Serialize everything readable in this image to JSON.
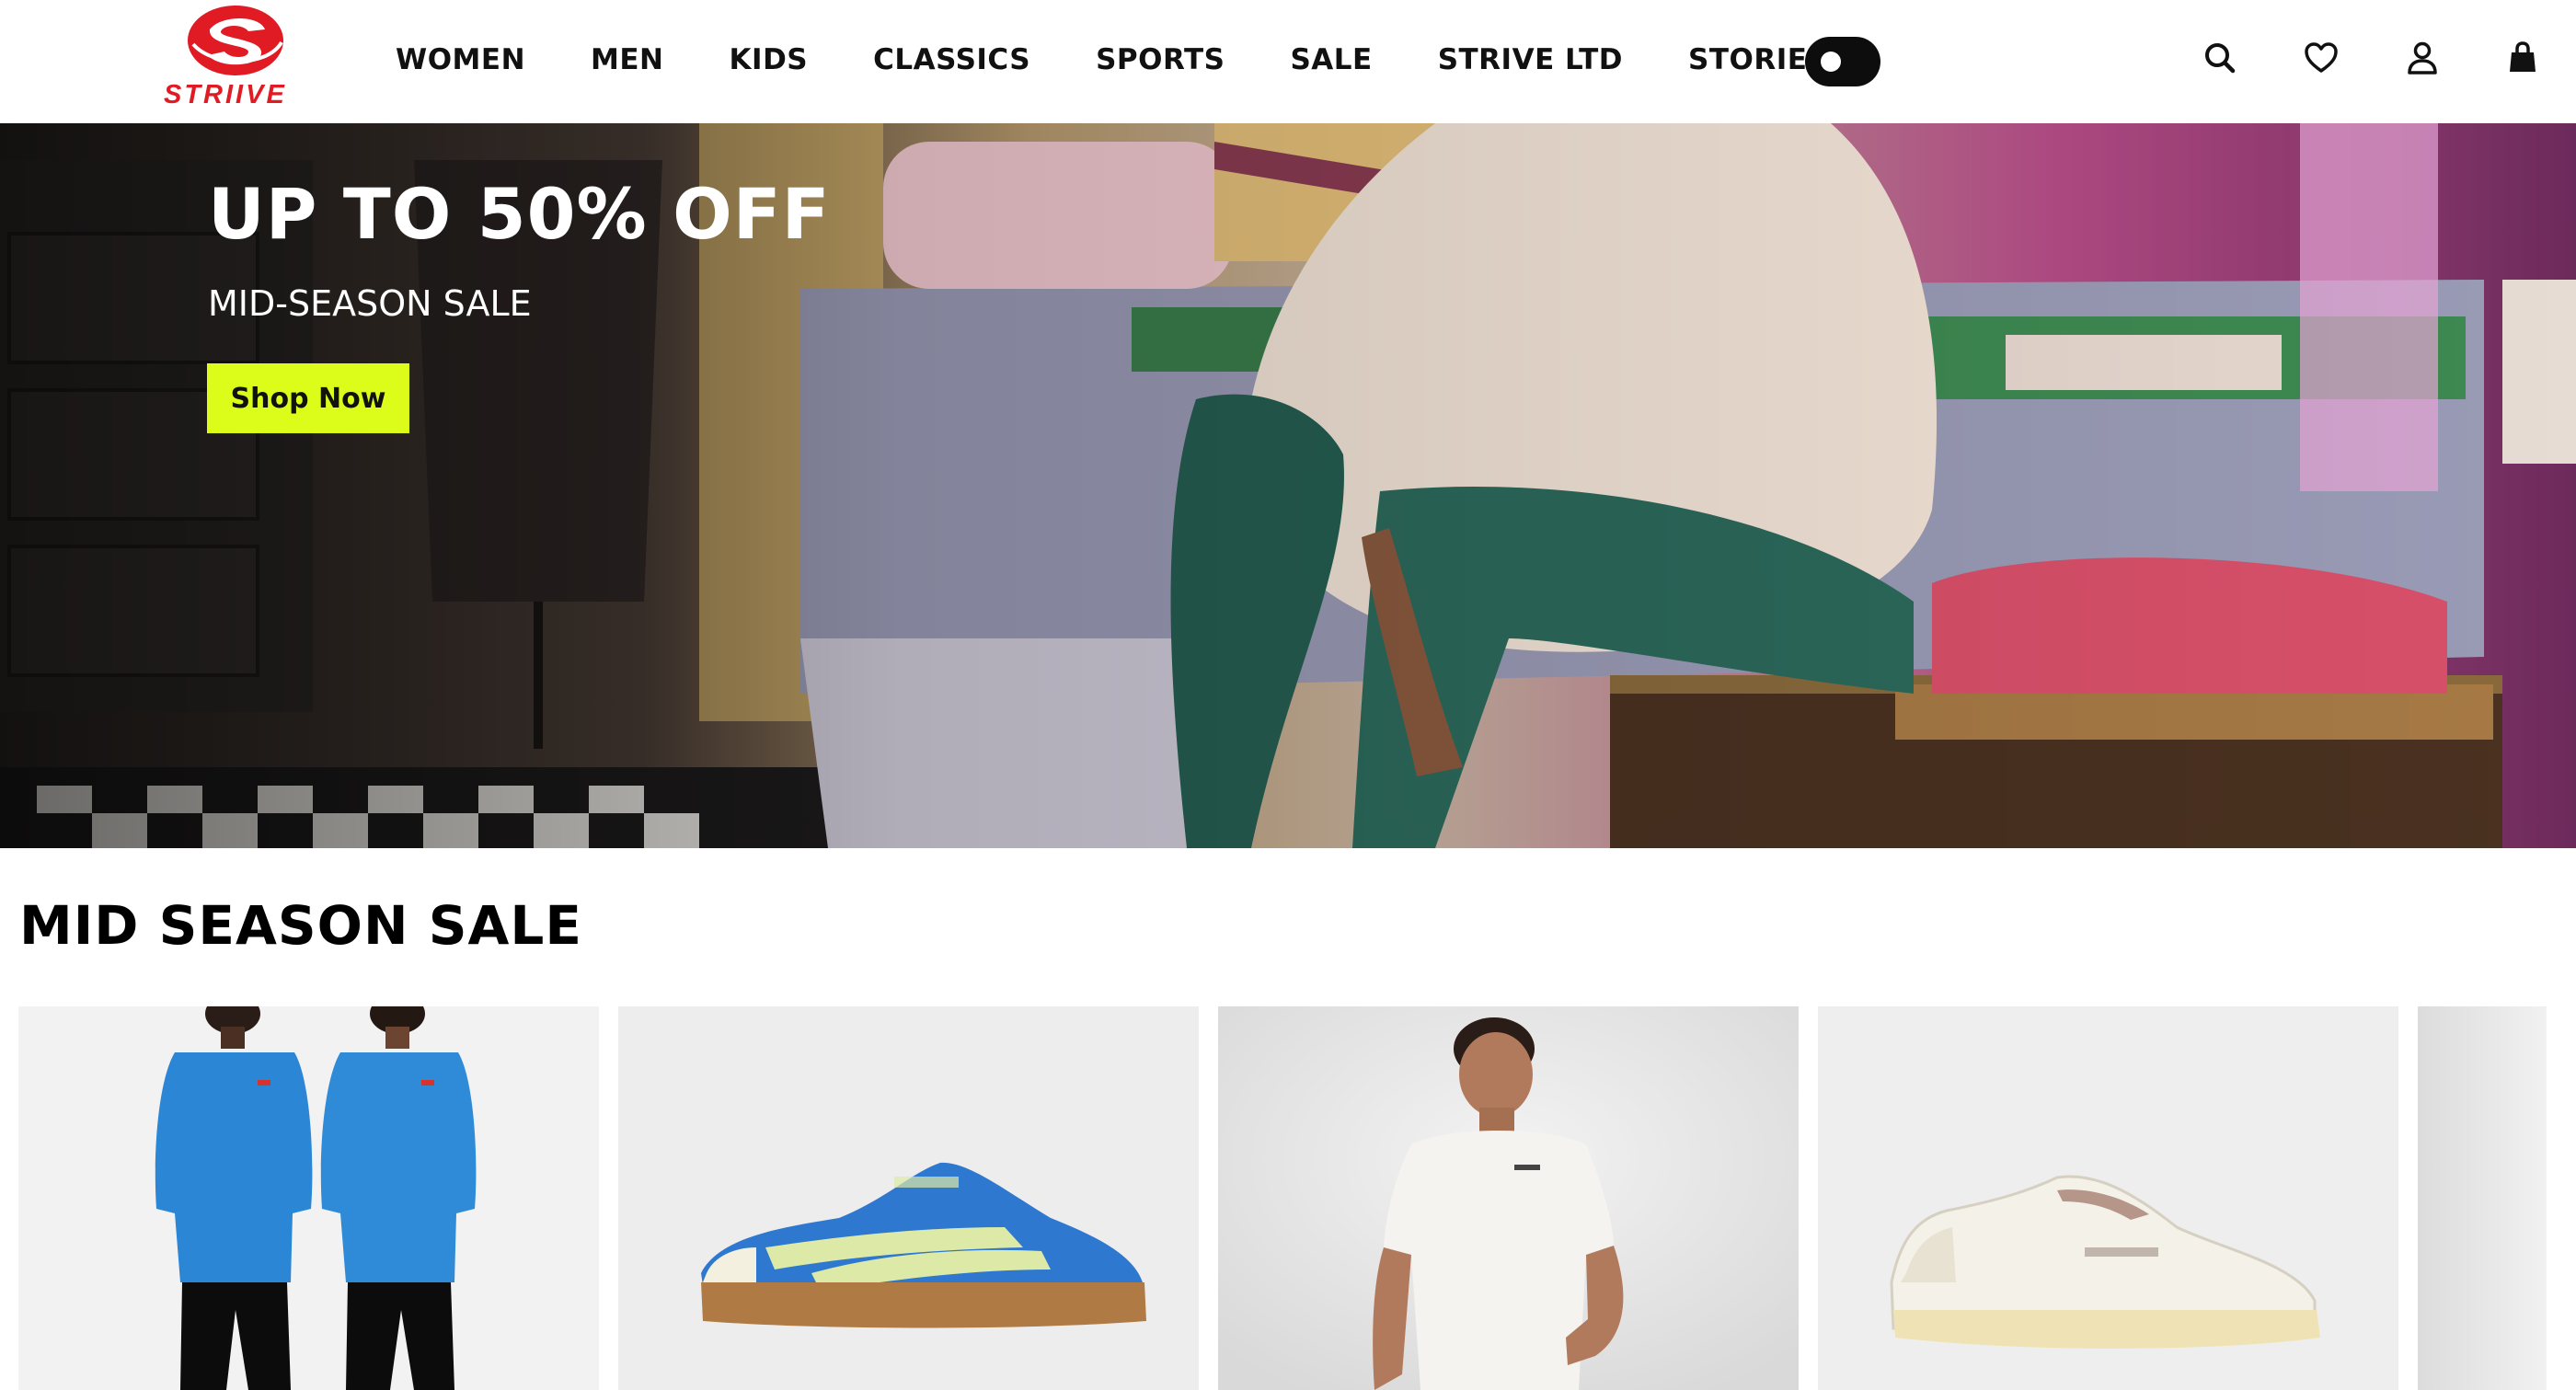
{
  "brand": {
    "name": "STRIIVE",
    "colors": {
      "red": "#e01b24",
      "accent": "#dcfc1a",
      "text": "#111111"
    }
  },
  "nav": {
    "items": [
      {
        "label": "WOMEN"
      },
      {
        "label": "MEN"
      },
      {
        "label": "KIDS"
      },
      {
        "label": "CLASSICS"
      },
      {
        "label": "SPORTS"
      },
      {
        "label": "SALE"
      },
      {
        "label": "STRIVE LTD"
      },
      {
        "label": "STORIES"
      }
    ],
    "theme_toggle": {
      "state": "dark"
    }
  },
  "header_icons": [
    "search-icon",
    "heart-icon",
    "user-icon",
    "bag-icon"
  ],
  "hero": {
    "title": "UP TO 50% OFF",
    "subtitle": "MID-SEASON SALE",
    "cta_label": "Shop Now"
  },
  "section": {
    "title": "MID SEASON SALE"
  },
  "products": [
    {
      "kind": "sweatshirt-models",
      "color": "#2b86d6"
    },
    {
      "kind": "sneaker-blue",
      "color": "#2f78cf"
    },
    {
      "kind": "white-tee-model",
      "color": "#f4f3ef"
    },
    {
      "kind": "sneaker-white",
      "color": "#f1ede2"
    },
    {
      "kind": "partial"
    }
  ]
}
